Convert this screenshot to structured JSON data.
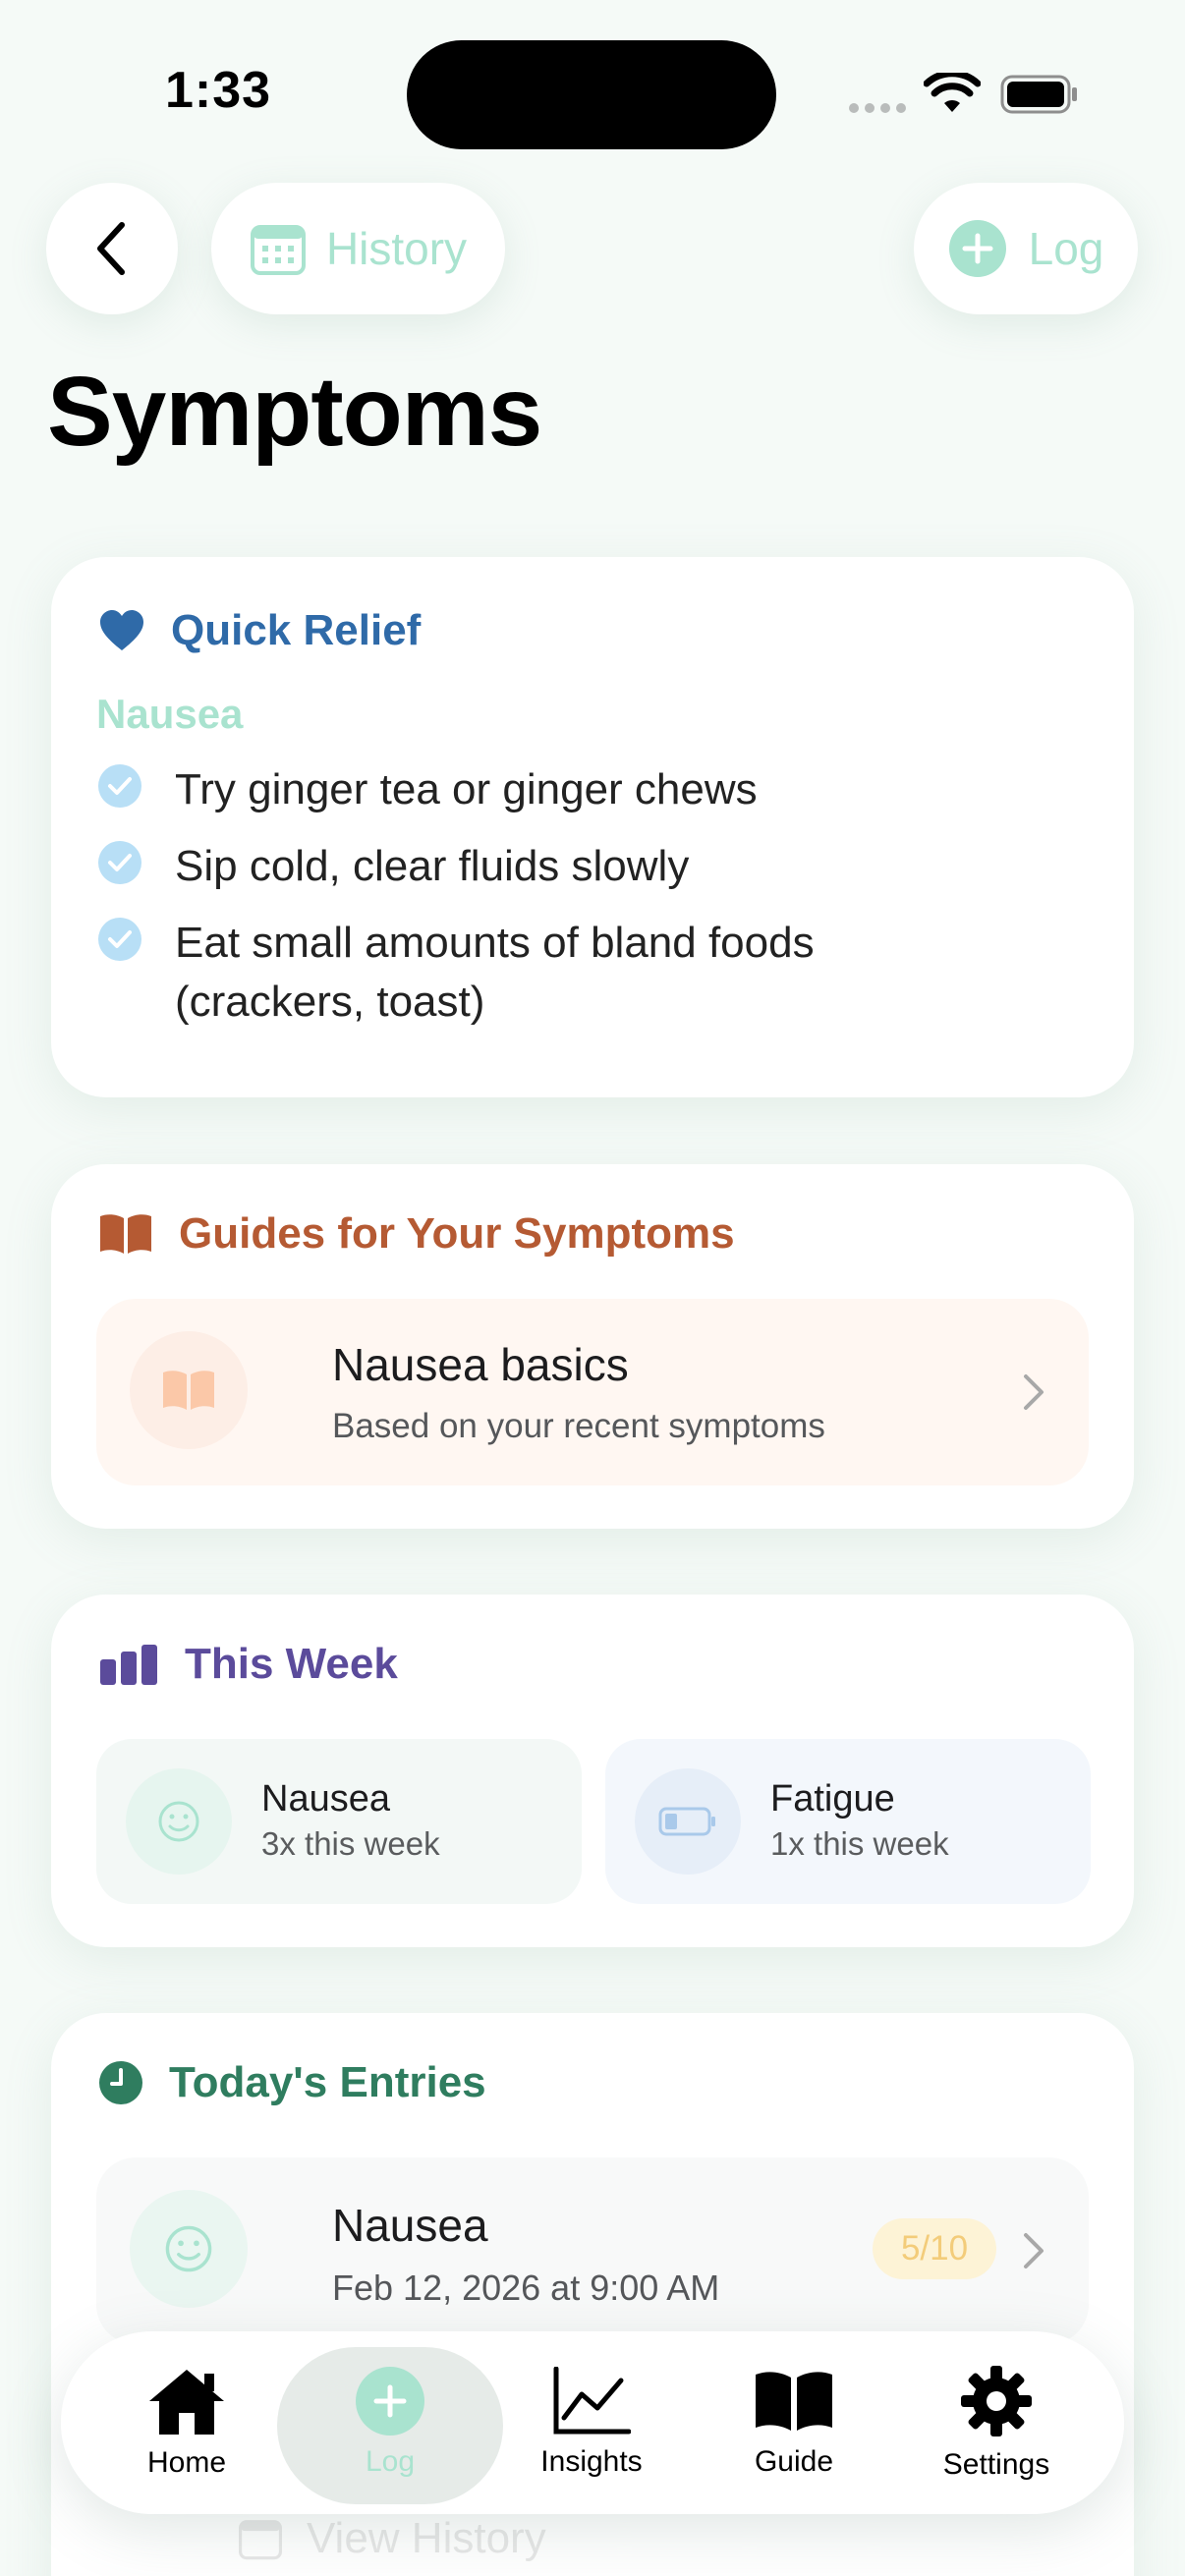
{
  "status_bar": {
    "time": "1:33"
  },
  "nav": {
    "history_label": "History",
    "log_label": "Log"
  },
  "page": {
    "title": "Symptoms"
  },
  "quick_relief": {
    "title": "Quick Relief",
    "symptom": "Nausea",
    "tips": [
      "Try ginger tea or ginger chews",
      "Sip cold, clear fluids slowly",
      "Eat small amounts of bland foods (crackers, toast)"
    ]
  },
  "guides": {
    "title": "Guides for Your Symptoms",
    "item": {
      "title": "Nausea basics",
      "subtitle": "Based on your recent symptoms"
    }
  },
  "this_week": {
    "title": "This Week",
    "items": [
      {
        "name": "Nausea",
        "count": "3x this week"
      },
      {
        "name": "Fatigue",
        "count": "1x this week"
      }
    ]
  },
  "todays_entries": {
    "title": "Today's Entries",
    "entries": [
      {
        "title": "Nausea",
        "time": "Feb 12, 2026 at 9:00 AM",
        "severity": "5/10"
      }
    ],
    "view_history": "View History"
  },
  "tab_bar": {
    "active": "Log",
    "tabs": [
      {
        "label": "Home",
        "icon": "house-icon"
      },
      {
        "label": "Log",
        "icon": "plus-circle-icon"
      },
      {
        "label": "Insights",
        "icon": "line-chart-icon"
      },
      {
        "label": "Guide",
        "icon": "book-icon"
      },
      {
        "label": "Settings",
        "icon": "gear-icon"
      }
    ]
  },
  "colors": {
    "mint_accent": "#a9e3cf",
    "quick_relief_blue": "#2f6aa8",
    "guides_orange": "#b55a33",
    "this_week_purple": "#5b4b9b",
    "entries_green": "#2f7d5f",
    "severity_badge": "#f3cc7a"
  }
}
